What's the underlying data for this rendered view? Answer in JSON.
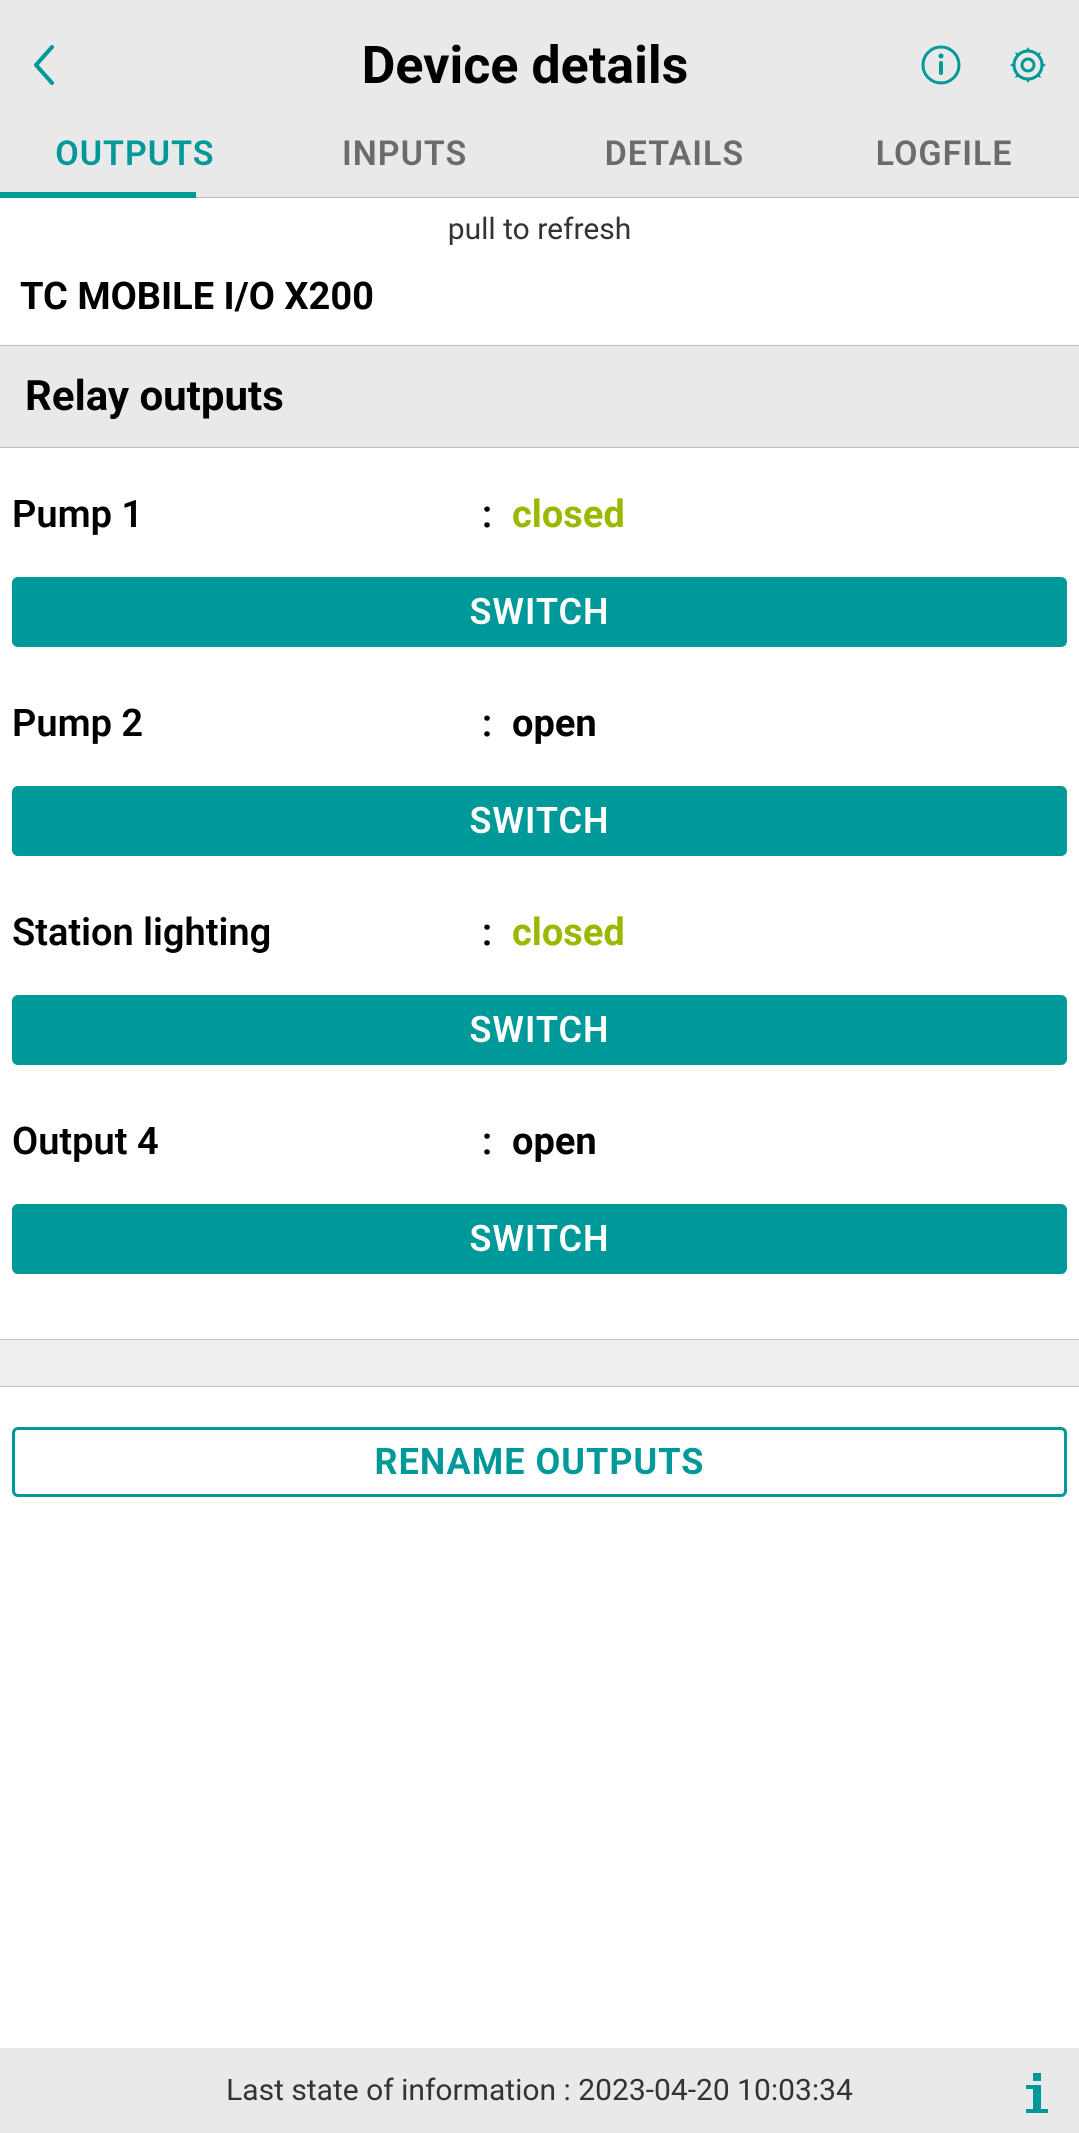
{
  "header": {
    "title": "Device details"
  },
  "tabs": [
    {
      "label": "OUTPUTS",
      "active": true
    },
    {
      "label": "INPUTS",
      "active": false
    },
    {
      "label": "DETAILS",
      "active": false
    },
    {
      "label": "LOGFILE",
      "active": false
    }
  ],
  "pull_refresh": "pull to refresh",
  "device_name": "TC MOBILE I/O X200",
  "section_title": "Relay outputs",
  "outputs": [
    {
      "label": "Pump 1",
      "status": "closed",
      "status_class": "closed",
      "button": "SWITCH"
    },
    {
      "label": "Pump 2",
      "status": "open",
      "status_class": "open",
      "button": "SWITCH"
    },
    {
      "label": "Station lighting",
      "status": "closed",
      "status_class": "closed",
      "button": "SWITCH"
    },
    {
      "label": "Output 4",
      "status": "open",
      "status_class": "open",
      "button": "SWITCH"
    }
  ],
  "rename_button": "RENAME OUTPUTS",
  "footer": {
    "prefix": "Last state of information : ",
    "timestamp": "2023-04-20 10:03:34"
  },
  "colors": {
    "accent": "#009999",
    "closed": "#99b900"
  }
}
